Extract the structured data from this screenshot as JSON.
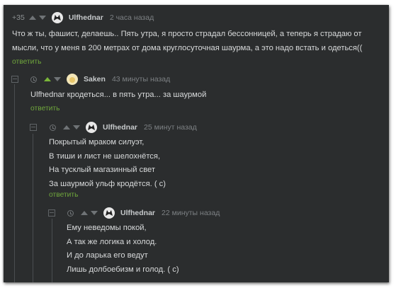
{
  "comments": [
    {
      "rating": "+35",
      "author": "Ulfhednar",
      "time": "2 часа назад",
      "text": [
        "Что ж ты, фашист, делаешь.. Пять утра, я просто страдал бессонницей, а теперь я страдаю от",
        "мысли, что у меня в 200 метрах от дома круглосуточная шаурма, а это надо встать и одеться(("
      ],
      "reply": "ответить"
    },
    {
      "author": "Saken",
      "time": "43 минуты назад",
      "text": [
        "Ulfhednar кродеться... в пять утра... за шаурмой"
      ],
      "reply": "ответить"
    },
    {
      "author": "Ulfhednar",
      "time": "25 минут назад",
      "text": [
        "Покрытый мраком силуэт,",
        "В тиши и лист не шелохнётся,",
        "На тусклый магазинный свет",
        "За шаурмой ульф кродётся. ( с)"
      ],
      "reply": "ответить"
    },
    {
      "author": "Ulfhednar",
      "time": "22 минуты назад",
      "text": [
        "Ему неведомы покой,",
        "А так же логика и холод.",
        "И до ларька его ведут",
        "Лишь долбоебизм и голод. ( с)"
      ]
    }
  ],
  "colors": {
    "background": "#2b2d2e",
    "text": "#d8dadb",
    "reply_link": "#6fa63c",
    "upvote_active": "#7ab539"
  },
  "icons": [
    "collapse-icon",
    "clock-icon",
    "upvote-icon",
    "downvote-icon",
    "avatar"
  ]
}
